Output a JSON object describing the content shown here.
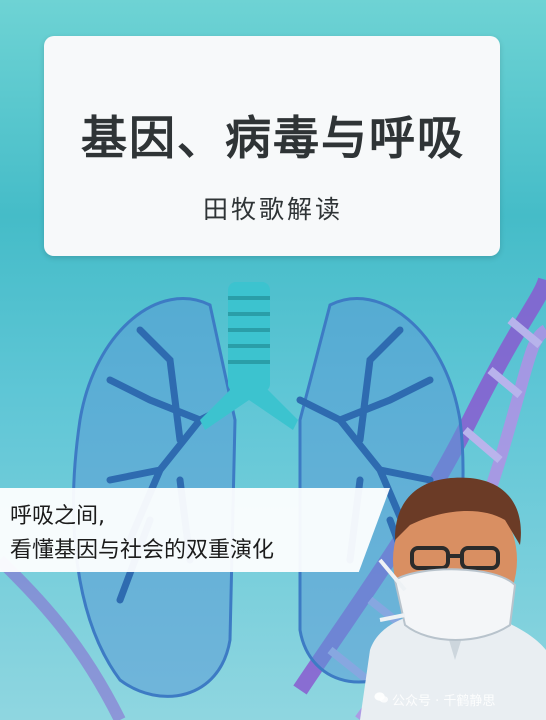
{
  "title": "基因、病毒与呼吸",
  "subtitle": "田牧歌解读",
  "banner": {
    "line1": "呼吸之间,",
    "line2": "看懂基因与社会的双重演化"
  },
  "watermark": "公众号 · 千鹤静思",
  "colors": {
    "background_top": "#6ed3d4",
    "lung": "#4a86c8",
    "trachea": "#3cc3cf",
    "dna": "#8a5ad0",
    "card": "#f7f9fa"
  },
  "icons": [
    "lungs-illustration",
    "dna-helix",
    "doctor-with-mask",
    "wechat-icon"
  ]
}
